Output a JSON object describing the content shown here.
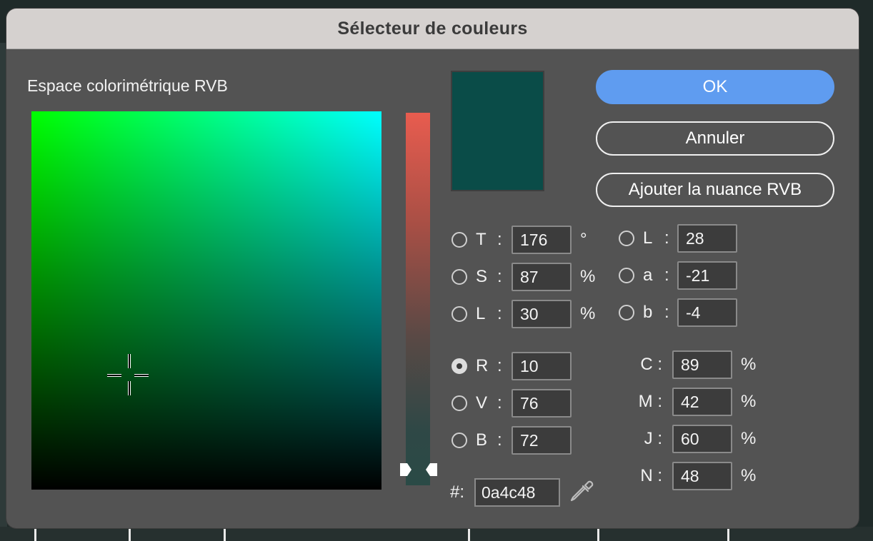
{
  "window": {
    "title": "Sélecteur de couleurs"
  },
  "colorspace_label": "Espace colorimétrique RVB",
  "current_color_hex": "#0a4c48",
  "buttons": {
    "ok": "OK",
    "cancel": "Annuler",
    "add_swatch": "Ajouter la nuance RVB"
  },
  "hsl": [
    {
      "label": "T",
      "value": "176",
      "unit": "°",
      "selected": false
    },
    {
      "label": "S",
      "value": "87",
      "unit": "%",
      "selected": false
    },
    {
      "label": "L",
      "value": "30",
      "unit": "%",
      "selected": false
    }
  ],
  "rgb": [
    {
      "label": "R",
      "value": "10",
      "selected": true
    },
    {
      "label": "V",
      "value": "76",
      "selected": false
    },
    {
      "label": "B",
      "value": "72",
      "selected": false
    }
  ],
  "lab": [
    {
      "label": "L",
      "value": "28",
      "selected": false
    },
    {
      "label": "a",
      "value": "-21",
      "selected": false
    },
    {
      "label": "b",
      "value": "-4",
      "selected": false
    }
  ],
  "cmyk": [
    {
      "label": "C",
      "value": "89",
      "unit": "%"
    },
    {
      "label": "M",
      "value": "42",
      "unit": "%"
    },
    {
      "label": "J",
      "value": "60",
      "unit": "%"
    },
    {
      "label": "N",
      "value": "48",
      "unit": "%"
    }
  ],
  "hex": {
    "label": "#:",
    "value": "0a4c48"
  },
  "colon": ":",
  "icons": {
    "eyedropper": "eyedropper-icon",
    "crosshair": "crosshair-icon"
  },
  "accent": "#5f9cf0"
}
